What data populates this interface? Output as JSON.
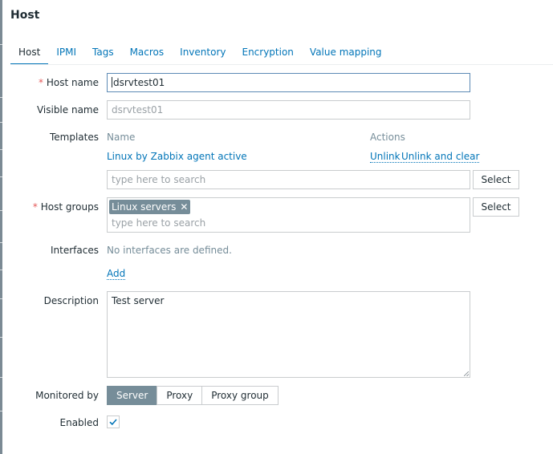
{
  "dialog": {
    "title": "Host"
  },
  "tabs": [
    {
      "label": "Host"
    },
    {
      "label": "IPMI"
    },
    {
      "label": "Tags"
    },
    {
      "label": "Macros"
    },
    {
      "label": "Inventory"
    },
    {
      "label": "Encryption"
    },
    {
      "label": "Value mapping"
    }
  ],
  "form": {
    "required_mark": "*",
    "host_name": {
      "label": "Host name",
      "value": "dsrvtest01"
    },
    "visible_name": {
      "label": "Visible name",
      "placeholder": "dsrvtest01"
    },
    "templates": {
      "label": "Templates",
      "col_name": "Name",
      "col_actions": "Actions",
      "linked": [
        {
          "name": "Linux by Zabbix agent active",
          "unlink": "Unlink",
          "unlink_clear": "Unlink and clear"
        }
      ],
      "search_placeholder": "type here to search",
      "select_button": "Select"
    },
    "host_groups": {
      "label": "Host groups",
      "chips": [
        "Linux servers"
      ],
      "chip_remove_glyph": "✕",
      "search_placeholder": "type here to search",
      "select_button": "Select"
    },
    "interfaces": {
      "label": "Interfaces",
      "empty_text": "No interfaces are defined.",
      "add_link": "Add"
    },
    "description": {
      "label": "Description",
      "value": "Test server"
    },
    "monitored_by": {
      "label": "Monitored by",
      "options": [
        "Server",
        "Proxy",
        "Proxy group"
      ],
      "selected": "Server"
    },
    "enabled": {
      "label": "Enabled",
      "checked": true
    }
  },
  "colors": {
    "accent": "#0275b8",
    "required": "#e45959",
    "selected_bg": "#768d99"
  },
  "icons": {
    "checkbox_mark": "check-icon",
    "chip_remove": "close-icon"
  }
}
